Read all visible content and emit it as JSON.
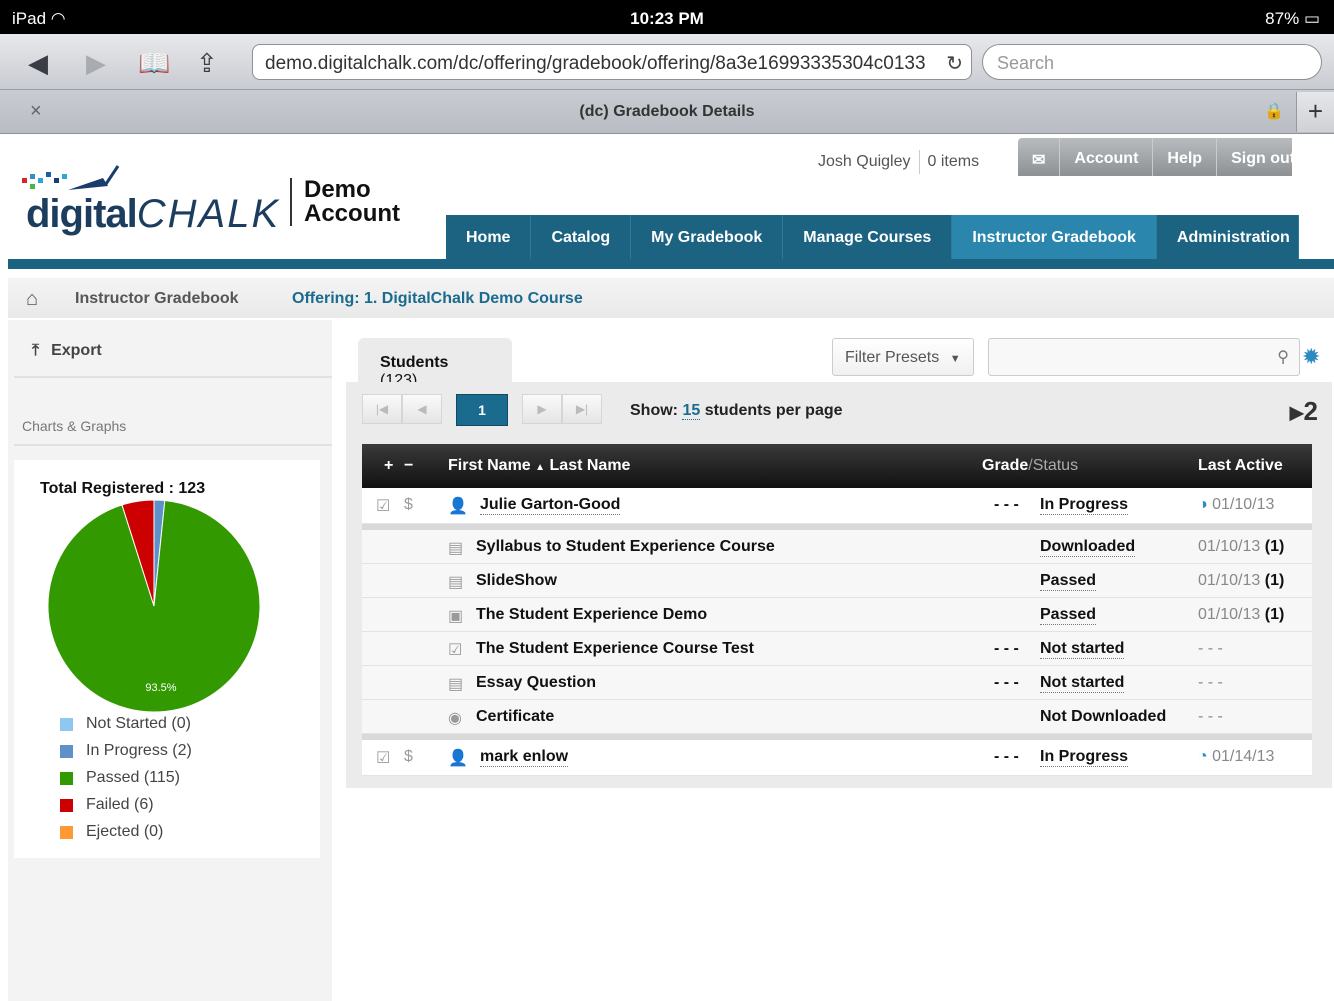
{
  "status_bar": {
    "device": "iPad",
    "wifi_icon": "wifi-icon",
    "time": "10:23 PM",
    "battery": "87%"
  },
  "browser": {
    "url": "demo.digitalchalk.com/dc/offering/gradebook/offering/8a3e16993335304c0133",
    "search_placeholder": "Search",
    "tab_title": "(dc) Gradebook Details",
    "close_label": "×",
    "new_tab_label": "+"
  },
  "header": {
    "logo_text_a": "digital",
    "logo_text_b": "CHALK",
    "account_line1": "Demo",
    "account_line2": "Account",
    "user_name": "Josh Quigley",
    "cart": "0 items",
    "top_links": [
      "Account",
      "Help",
      "Sign out"
    ],
    "nav": [
      "Home",
      "Catalog",
      "My Gradebook",
      "Manage Courses",
      "Instructor Gradebook",
      "Administration"
    ],
    "active_nav": "Instructor Gradebook"
  },
  "breadcrumb": {
    "root": "Instructor Gradebook",
    "current": "Offering: 1. DigitalChalk Demo Course"
  },
  "sidebar": {
    "export_label": "Export",
    "charts_heading": "Charts & Graphs",
    "chart_title": "Total Registered : 123",
    "slice_label": "93.5%",
    "legend": [
      {
        "label": "Not Started (0)",
        "color": "#8ec7ef",
        "value": 0
      },
      {
        "label": "In Progress (2)",
        "color": "#5e91c9",
        "value": 2
      },
      {
        "label": "Passed (115)",
        "color": "#339900",
        "value": 115
      },
      {
        "label": "Failed (6)",
        "color": "#cc0000",
        "value": 6
      },
      {
        "label": "Ejected (0)",
        "color": "#ff9933",
        "value": 0
      }
    ]
  },
  "main": {
    "tab_label": "Students",
    "tab_count": "(123)",
    "filter_label": "Filter Presets",
    "current_page": "1",
    "show_prefix": "Show:",
    "show_count": "15",
    "show_suffix": "students per page",
    "page_total": "2",
    "columns": {
      "expand": "+",
      "collapse": "−",
      "first_name": "First Name",
      "sort_arrow": "▲",
      "last_name": "Last Name",
      "grade": "Grade",
      "status": "Status",
      "last_active": "Last Active"
    },
    "student1": {
      "name": "Julie Garton-Good",
      "grade": "- - -",
      "status": "In Progress",
      "last_active": "01/10/13"
    },
    "items": [
      {
        "name": "Syllabus to Student Experience Course",
        "grade": "",
        "status": "Downloaded",
        "date": "01/10/13",
        "count": "(1)",
        "icon": "document-icon"
      },
      {
        "name": "SlideShow",
        "grade": "",
        "status": "Passed",
        "date": "01/10/13",
        "count": "(1)",
        "icon": "slideshow-icon"
      },
      {
        "name": "The Student Experience Demo",
        "grade": "",
        "status": "Passed",
        "date": "01/10/13",
        "count": "(1)",
        "icon": "video-icon"
      },
      {
        "name": "The Student Experience Course Test",
        "grade": "- - -",
        "status": "Not started",
        "date": "- - -",
        "count": "",
        "icon": "test-icon"
      },
      {
        "name": "Essay Question",
        "grade": "- - -",
        "status": "Not started",
        "date": "- - -",
        "count": "",
        "icon": "essay-icon"
      },
      {
        "name": "Certificate",
        "grade": "",
        "status": "Not Downloaded",
        "date": "- - -",
        "count": "",
        "icon": "certificate-icon"
      }
    ],
    "student2": {
      "name": "mark enlow",
      "grade": "- - -",
      "status": "In Progress",
      "last_active": "01/14/13"
    }
  }
}
